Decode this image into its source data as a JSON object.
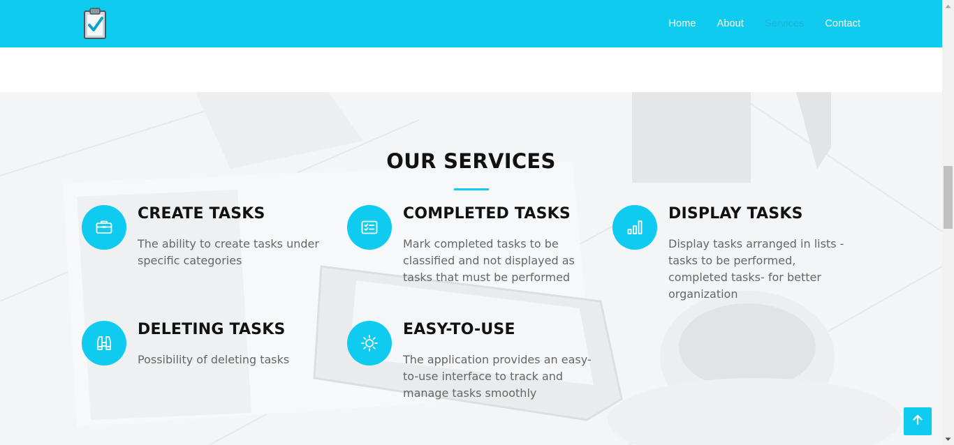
{
  "nav": {
    "links": [
      "Home",
      "About",
      "Services",
      "Contact"
    ],
    "active": "Services"
  },
  "icons": {
    "logo": "clipboard-check-icon",
    "back_to_top": "arrow-up-icon"
  },
  "colors": {
    "accent": "#0ecbef",
    "heading": "#111111",
    "body_text": "#666666"
  },
  "services": {
    "title": "OUR SERVICES",
    "items": [
      {
        "heading": "CREATE TASKS",
        "description": "The ability to create tasks under specific categories",
        "icon": "briefcase-icon"
      },
      {
        "heading": "COMPLETED TASKS",
        "description": "Mark completed tasks to be classified and not displayed as tasks that must be performed",
        "icon": "checklist-icon"
      },
      {
        "heading": "DISPLAY TASKS",
        "description": "Display tasks arranged in lists -tasks to be performed, completed tasks- for better organization",
        "icon": "bar-chart-icon"
      },
      {
        "heading": "DELETING TASKS",
        "description": "Possibility of deleting tasks",
        "icon": "binoculars-icon"
      },
      {
        "heading": "EASY-TO-USE",
        "description": "The application provides an easy-to-use interface to track and manage tasks smoothly",
        "icon": "sun-icon"
      }
    ]
  }
}
